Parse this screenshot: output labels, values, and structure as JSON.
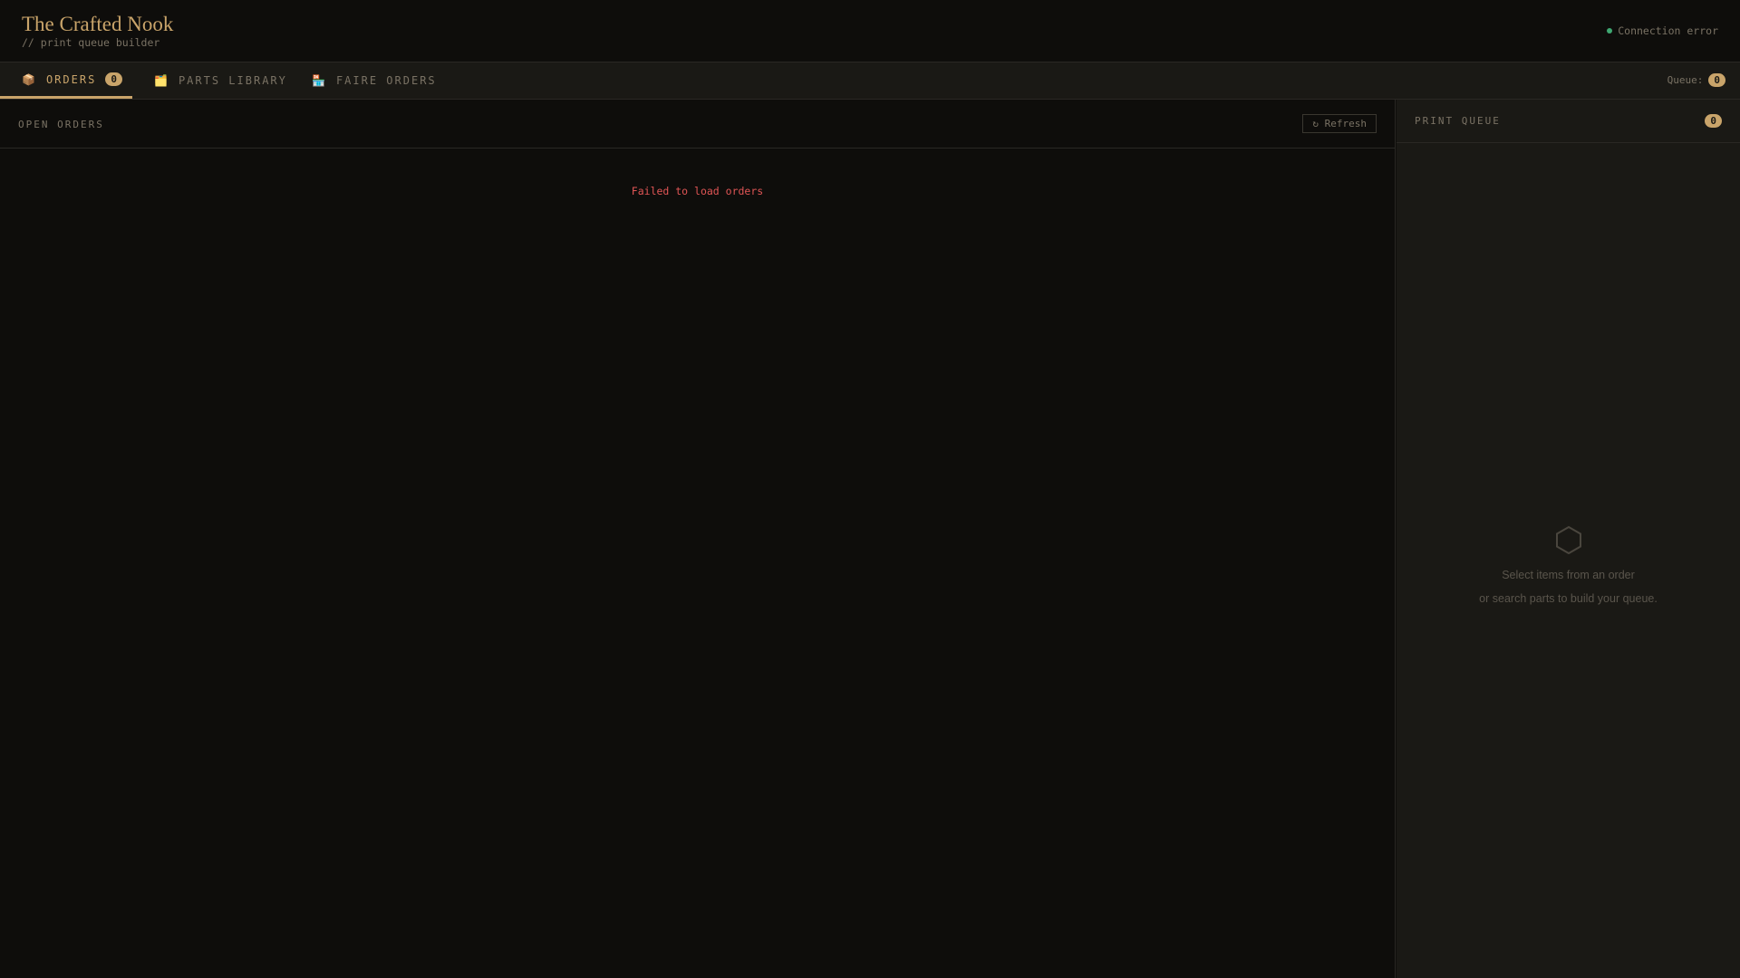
{
  "header": {
    "title": "The Crafted Nook",
    "subtitle": "// print queue builder",
    "status": "Connection error",
    "status_color": "#3fa772"
  },
  "tabs": [
    {
      "icon": "📦",
      "label": "ORDERS",
      "count": "0"
    },
    {
      "icon": "🗂️",
      "label": "PARTS LIBRARY"
    },
    {
      "icon": "🏪",
      "label": "FAIRE ORDERS"
    }
  ],
  "queue": {
    "label": "Queue:",
    "count": "0"
  },
  "orders": {
    "title": "OPEN ORDERS",
    "refresh": "↻ Refresh",
    "error": "Failed to load orders"
  },
  "print_queue": {
    "title": "PRINT QUEUE",
    "count": "0",
    "empty_line1": "Select items from an order",
    "empty_line2": "or search parts to build your queue."
  }
}
